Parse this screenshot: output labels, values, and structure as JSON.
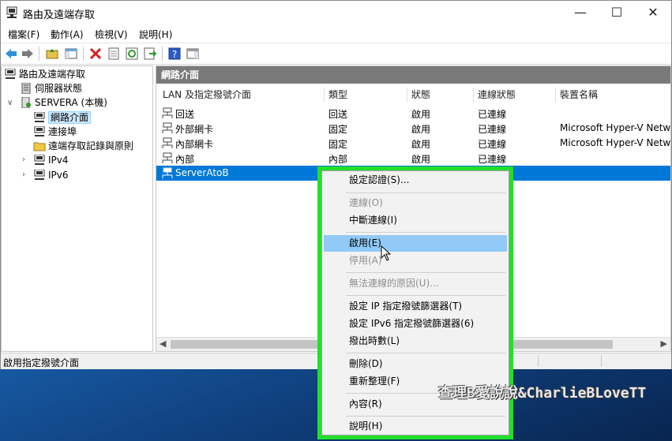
{
  "window": {
    "title": "路由及遠端存取"
  },
  "menus": [
    "檔案(F)",
    "動作(A)",
    "檢視(V)",
    "說明(H)"
  ],
  "tree": {
    "root": "路由及遠端存取",
    "server_status": "伺服器狀態",
    "server": "SERVERA (本機)",
    "network_interfaces": "網路介面",
    "ports": "連接埠",
    "remote_logging": "遠端存取記錄與原則",
    "ipv4": "IPv4",
    "ipv6": "IPv6"
  },
  "list": {
    "title": "網路介面",
    "columns": [
      "LAN 及指定撥號介面",
      "類型",
      "狀態",
      "連線狀態",
      "裝置名稱"
    ],
    "rows": [
      [
        "回送",
        "回送",
        "啟用",
        "已連線",
        ""
      ],
      [
        "外部網卡",
        "固定",
        "啟用",
        "已連線",
        "Microsoft Hyper-V Netwo"
      ],
      [
        "內部網卡",
        "固定",
        "啟用",
        "已連線",
        "Microsoft Hyper-V Netwo"
      ],
      [
        "內部",
        "內部",
        "啟用",
        "已連線",
        ""
      ],
      [
        "ServerAtoB",
        "",
        "",
        "",
        ""
      ]
    ]
  },
  "status": "啟用指定撥號介面",
  "context_menu": {
    "set_credentials": "設定認證(S)...",
    "connect": "連線(O)",
    "disconnect": "中斷連線(I)",
    "enable": "啟用(E)",
    "disable": "停用(A)",
    "unreachability": "無法連線的原因(U)...",
    "ip_filters": "設定 IP 指定撥號篩選器(T)",
    "ipv6_filters": "設定 IPv6 指定撥號篩選器(6)",
    "dial_out_hours": "撥出時數(L)",
    "delete": "刪除(D)",
    "rename": "重新整理(F)",
    "properties": "內容(R)",
    "help": "說明(H)"
  },
  "watermark": "查理B愛說說&CharlieBLoveTT",
  "colors": {
    "highlight_outline": "#22e02a",
    "selection": "#0078d7",
    "hover": "#91c9f7"
  }
}
